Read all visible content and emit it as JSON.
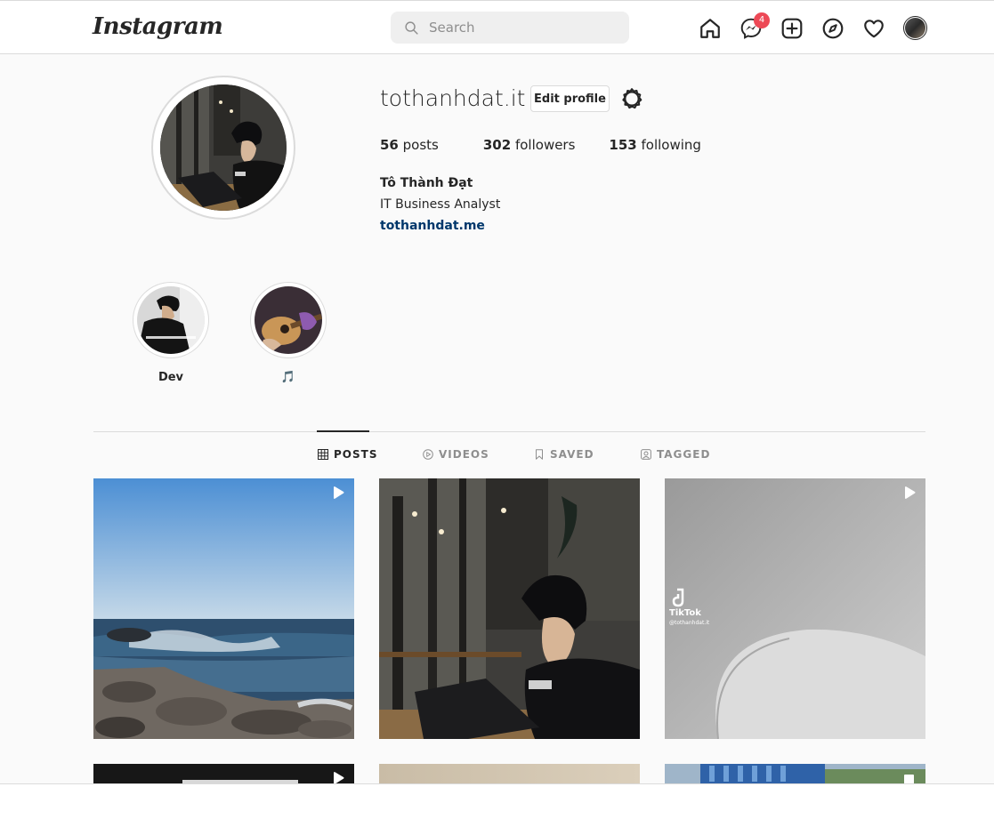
{
  "nav": {
    "logo": "Instagram",
    "search_placeholder": "Search",
    "message_badge": "4",
    "icons": [
      "home-icon",
      "messenger-icon",
      "new-post-icon",
      "explore-icon",
      "activity-heart-icon",
      "profile-avatar"
    ]
  },
  "profile": {
    "username": "tothanhdat.it",
    "edit_label": "Edit profile",
    "posts_count": "56",
    "posts_label": "posts",
    "followers_count": "302",
    "followers_label": "followers",
    "following_count": "153",
    "following_label": "following",
    "full_name": "Tô Thành Đạt",
    "bio": "IT Business Analyst",
    "website": "tothanhdat.me"
  },
  "highlights": [
    {
      "label": "Dev"
    },
    {
      "label": "🎵"
    }
  ],
  "tabs": [
    {
      "label": "POSTS",
      "icon": "grid-icon",
      "active": true
    },
    {
      "label": "VIDEOS",
      "icon": "play-circle-icon",
      "active": false
    },
    {
      "label": "SAVED",
      "icon": "bookmark-icon",
      "active": false
    },
    {
      "label": "TAGGED",
      "icon": "tagged-icon",
      "active": false
    }
  ],
  "posts": {
    "tiktok_label": "TikTok",
    "tiktok_handle": "@tothanhdat.it"
  },
  "colors": {
    "badge": "#ed4956",
    "link": "#00376b",
    "border": "#dbdbdb",
    "background": "#fafafa"
  }
}
